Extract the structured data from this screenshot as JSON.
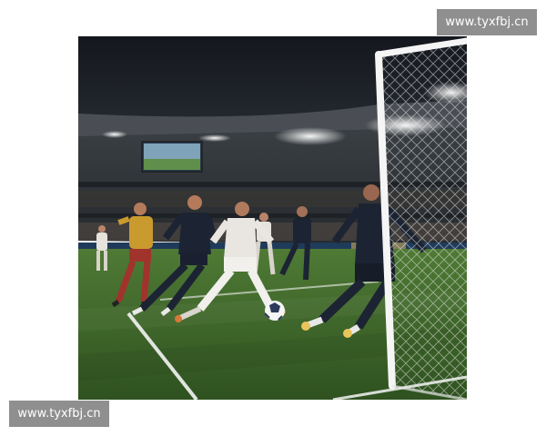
{
  "watermark_top": "www.tyxfbj.cn",
  "watermark_bottom": "www.tyxfbj.cn",
  "photo": {
    "subject": "football-match-goalmouth",
    "colors": {
      "night_sky": "#1b1f27",
      "pitch": "#3f6a2a",
      "pitch_light": "#4d7a33",
      "dark_kit": "#1c2433",
      "white_kit": "#e9e6e1",
      "red_kit": "#a0342c",
      "gold_kit": "#c99a2e",
      "net": "#f2f2f2"
    }
  }
}
